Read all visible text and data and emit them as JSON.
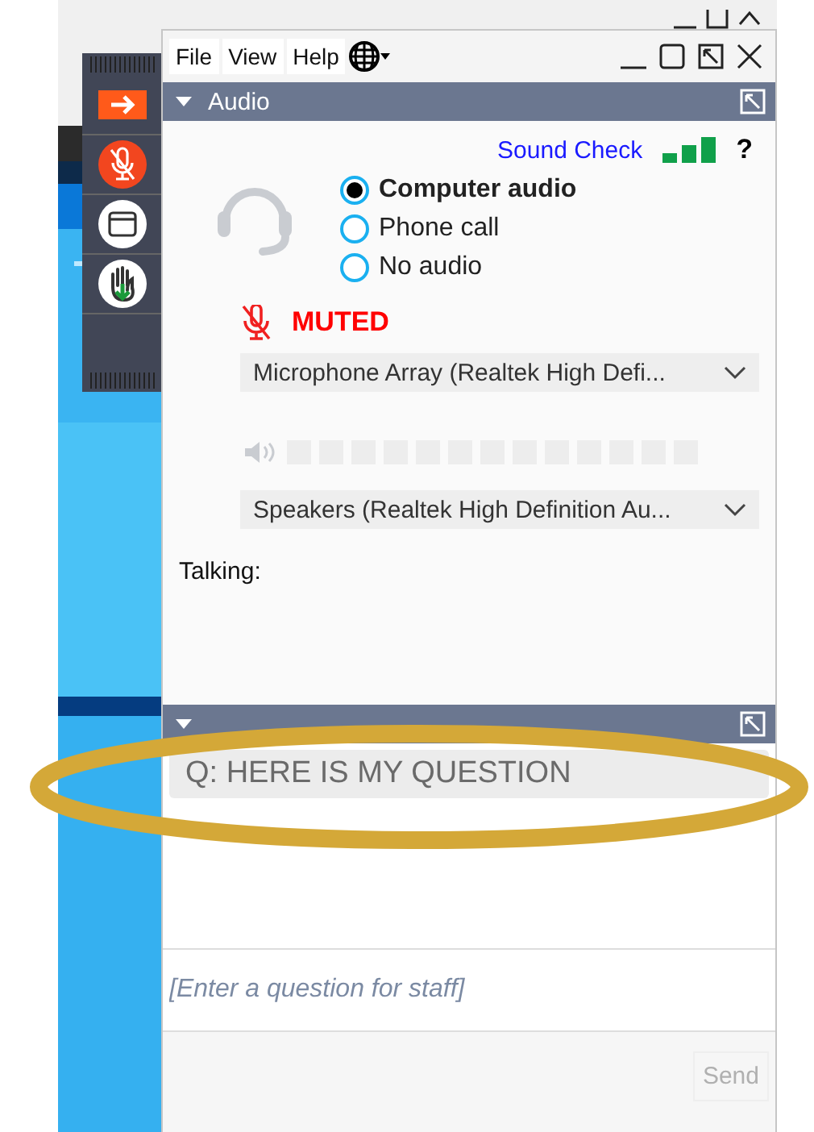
{
  "menu": [
    "File",
    "View",
    "Help"
  ],
  "audio": {
    "title": "Audio",
    "expanded": true,
    "sound_check": "Sound Check",
    "help": "?",
    "options": [
      {
        "label": "Computer audio",
        "selected": true
      },
      {
        "label": "Phone call",
        "selected": false
      },
      {
        "label": "No audio",
        "selected": false
      }
    ],
    "muted_label": "MUTED",
    "microphone": "Microphone Array (Realtek High Defi...",
    "speakers": "Speakers (Realtek High Definition Au...",
    "talking_label": "Talking:"
  },
  "questions": {
    "expanded": true,
    "items": [
      "Q: HERE IS MY QUESTION"
    ],
    "input": {
      "placeholder": "[Enter a question for staff]"
    },
    "send_button": {
      "label": "Send",
      "disabled": true
    }
  }
}
